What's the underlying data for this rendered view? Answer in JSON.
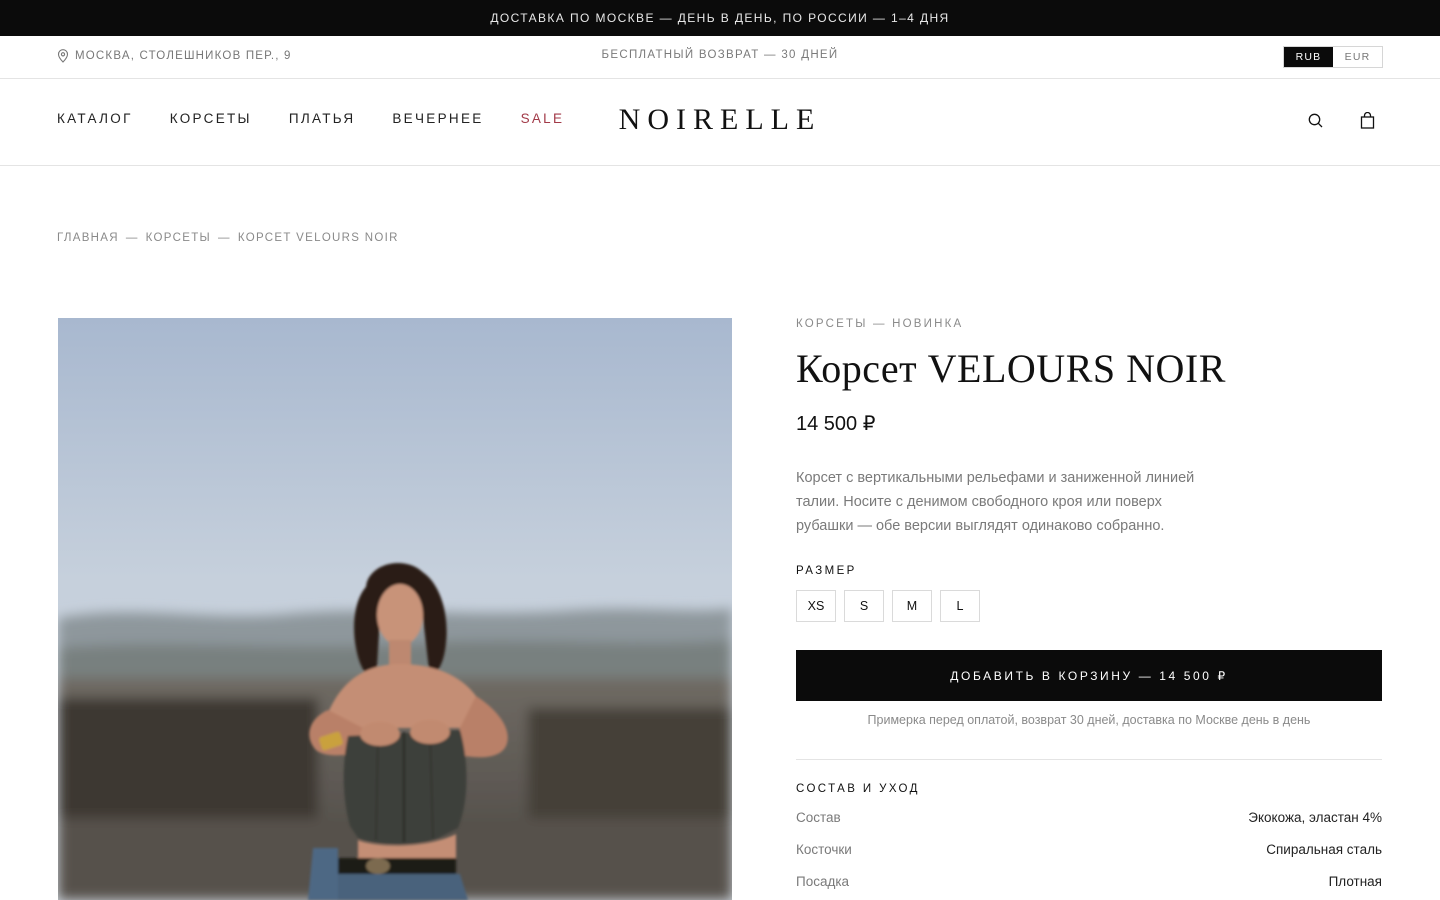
{
  "promo_bar": {
    "text": "ДОСТАВКА ПО МОСКВЕ — ДЕНЬ В ДЕНЬ, ПО РОССИИ — 1–4 ДНЯ"
  },
  "utility_bar": {
    "address": "МОСКВА, СТОЛЕШНИКОВ ПЕР., 9",
    "returns": "БЕСПЛАТНЫЙ ВОЗВРАТ — 30 ДНЕЙ",
    "currencies": [
      "RUB",
      "EUR"
    ],
    "active_currency": "RUB"
  },
  "header": {
    "nav": [
      "КАТАЛОГ",
      "КОРСЕТЫ",
      "ПЛАТЬЯ",
      "ВЕЧЕРНЕЕ",
      "SALE"
    ],
    "logo": "NOIRELLE",
    "icons": [
      "search-icon",
      "bag-icon"
    ],
    "sale_color": "#a23a48"
  },
  "breadcrumb": [
    "ГЛАВНАЯ",
    "—",
    "КОРСЕТЫ",
    "—",
    "КОРСЕТ VELOURS NOIR"
  ],
  "product": {
    "eyebrow": "КОРСЕТЫ — НОВИНКА",
    "title": "Корсет VELOURS NOIR",
    "price": "14 500 ₽",
    "description": "Корсет с вертикальными рельефами и заниженной линией талии. Носите с денимом свободного кроя или поверх рубашки — обе версии выглядят одинаково собранно.",
    "size_label": "РАЗМЕР",
    "sizes": [
      "XS",
      "S",
      "M",
      "L"
    ],
    "add_to_cart": "ДОБАВИТЬ В КОРЗИНУ — 14 500 ₽",
    "note": "Примерка перед оплатой, возврат 30 дней, доставка по Москве день в день",
    "composition_label": "СОСТАВ И УХОД",
    "specs": [
      {
        "key": "Состав",
        "value": "Экокожа, эластан 4%"
      },
      {
        "key": "Косточки",
        "value": "Спиральная сталь"
      },
      {
        "key": "Посадка",
        "value": "Плотная"
      }
    ]
  }
}
